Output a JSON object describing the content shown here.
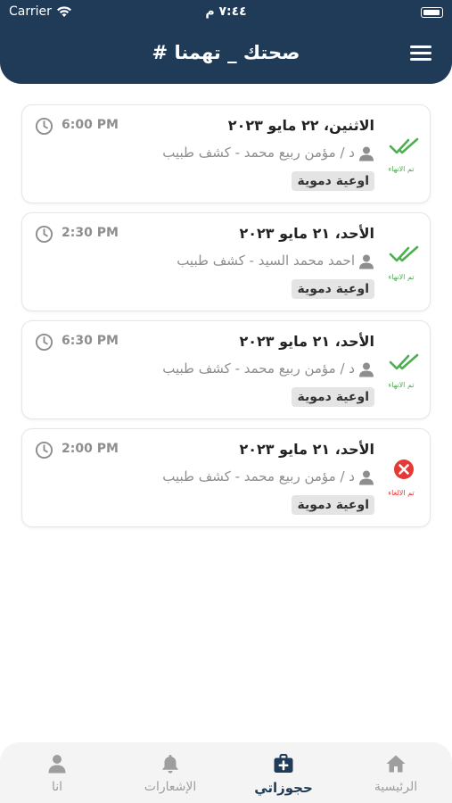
{
  "status_bar": {
    "carrier": "Carrier",
    "time": "٧:٤٤ م"
  },
  "header": {
    "title": "# صحتك _ تهمنا",
    "menu_icon": "hamburger-menu-icon",
    "background_color": "#1f3b57"
  },
  "bookings": [
    {
      "date": "الاثنين، ٢٢ مايو ٢٠٢٣",
      "time": "6:00 PM",
      "doctor": "د / مؤمن ربيع محمد - كشف طبيب",
      "specialty": "اوعية دموية",
      "status": "done",
      "status_label": "تم الانهاء",
      "status_icon": "double-check-icon"
    },
    {
      "date": "الأحد، ٢١ مايو ٢٠٢٣",
      "time": "2:30 PM",
      "doctor": "احمد محمد السيد - كشف طبيب",
      "specialty": "اوعية دموية",
      "status": "done",
      "status_label": "تم الانهاء",
      "status_icon": "double-check-icon"
    },
    {
      "date": "الأحد، ٢١ مايو ٢٠٢٣",
      "time": "6:30 PM",
      "doctor": "د / مؤمن ربيع محمد - كشف طبيب",
      "specialty": "اوعية دموية",
      "status": "done",
      "status_label": "تم الانهاء",
      "status_icon": "double-check-icon"
    },
    {
      "date": "الأحد، ٢١ مايو ٢٠٢٣",
      "time": "2:00 PM",
      "doctor": "د / مؤمن ربيع محمد - كشف طبيب",
      "specialty": "اوعية دموية",
      "status": "cancelled",
      "status_label": "تم الالغاء",
      "status_icon": "cancel-x-icon"
    }
  ],
  "bottom_nav": {
    "items": [
      {
        "label": "الرئيسية",
        "icon": "home-icon",
        "active": false
      },
      {
        "label": "حجوزاتي",
        "icon": "medical-bag-icon",
        "active": true
      },
      {
        "label": "الإشعارات",
        "icon": "bell-icon",
        "active": false
      },
      {
        "label": "انا",
        "icon": "profile-icon",
        "active": false
      }
    ]
  },
  "colors": {
    "primary": "#1f3b57",
    "done": "#4caf50",
    "cancelled": "#e53935",
    "muted_text": "#8e8e8e"
  }
}
